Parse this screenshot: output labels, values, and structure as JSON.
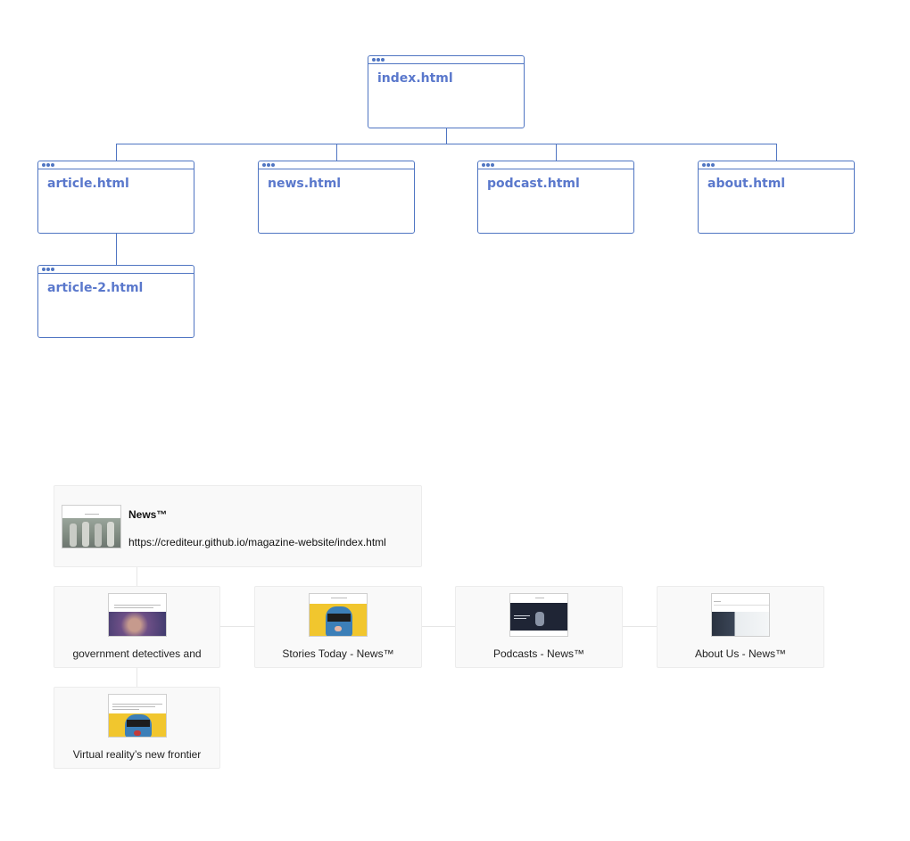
{
  "sitemap": {
    "nodes": [
      {
        "id": "index",
        "label": "index.html"
      },
      {
        "id": "article",
        "label": "article.html"
      },
      {
        "id": "news",
        "label": "news.html"
      },
      {
        "id": "podcast",
        "label": "podcast.html"
      },
      {
        "id": "about",
        "label": "about.html"
      },
      {
        "id": "article2",
        "label": "article-2.html"
      }
    ],
    "edges": [
      [
        "index",
        "article"
      ],
      [
        "index",
        "news"
      ],
      [
        "index",
        "podcast"
      ],
      [
        "index",
        "about"
      ],
      [
        "article",
        "article2"
      ]
    ],
    "accent_color": "#4f75c2",
    "label_color": "#5a78cc"
  },
  "previews": {
    "root": {
      "title": "News™",
      "url": "https://crediteur.github.io/magazine-website/index.html"
    },
    "children": [
      {
        "label": "government detectives and"
      },
      {
        "label": "Stories Today - News™"
      },
      {
        "label": "Podcasts - News™"
      },
      {
        "label": "About Us - News™"
      }
    ],
    "grandchildren": [
      {
        "label": "Virtual reality’s new frontier"
      }
    ]
  }
}
